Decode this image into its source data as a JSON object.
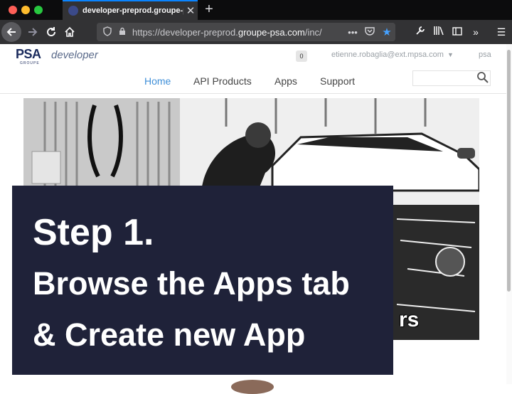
{
  "browser": {
    "tab_title": "developer-preprod.groupe-psa.com/inc/",
    "url_prefix": "https://developer-preprod.",
    "url_domain": "groupe-psa.com",
    "url_suffix": "/inc/",
    "new_tab_glyph": "+",
    "tab_close_glyph": "✕",
    "icons": [
      "back-icon",
      "forward-icon",
      "reload-icon",
      "home-icon",
      "shield-icon",
      "lock-icon",
      "more-icon",
      "pocket-icon",
      "bookmark-star-icon",
      "wrench-icon",
      "library-icon",
      "sidebar-icon",
      "overflow-icon",
      "hamburger-menu-icon"
    ],
    "accent": "#0a84ff"
  },
  "site": {
    "logo_brand": "PSA",
    "logo_word": "developer",
    "logo_sub": "GROUPE",
    "notification_count": "0",
    "user_email": "etienne.robaglia@ext.mpsa.com",
    "org": "psa",
    "nav": [
      {
        "label": "Home",
        "active": true
      },
      {
        "label": "API Products",
        "active": false
      },
      {
        "label": "Apps",
        "active": false
      },
      {
        "label": "Support",
        "active": false
      }
    ],
    "search_placeholder": "",
    "active_color": "#3f8fd8"
  },
  "hero": {
    "visible_text": "rs"
  },
  "overlay": {
    "step": "Step 1.",
    "line1": "Browse the Apps tab",
    "line2": "& Create new App",
    "background": "#1f2239"
  }
}
